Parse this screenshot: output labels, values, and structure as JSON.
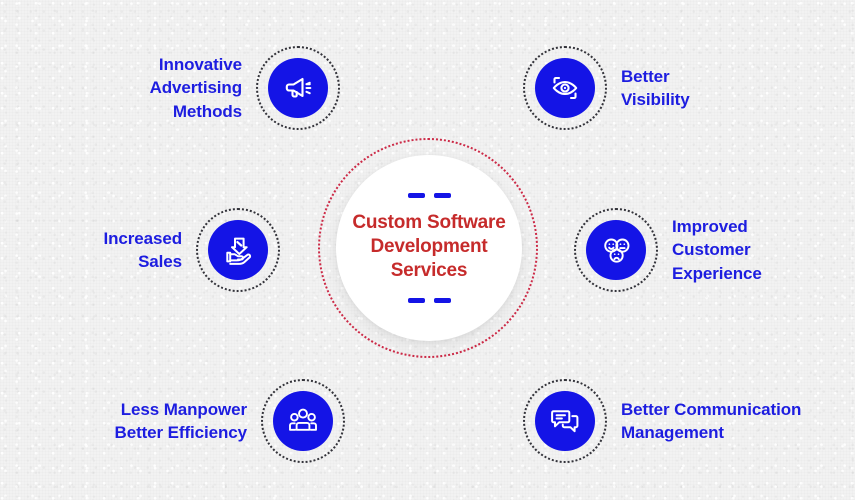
{
  "palette": {
    "background": "#f2f2f2",
    "icon_blue": "#1414e6",
    "label_blue": "#1d1de0",
    "center_red": "#c62b2b",
    "ring_red": "#cc2a47",
    "ring_dark": "#33333a",
    "center_disc": "#ffffff"
  },
  "center": {
    "title": "Custom Software\nDevelopment\nServices"
  },
  "nodes": [
    {
      "id": "innovative-advertising",
      "label": "Innovative\nAdvertising\nMethods",
      "icon": "megaphone-icon",
      "side": "left"
    },
    {
      "id": "better-visibility",
      "label": "Better\nVisibility",
      "icon": "eye-focus-icon",
      "side": "right"
    },
    {
      "id": "increased-sales",
      "label": "Increased\nSales",
      "icon": "hand-discount-arrow-icon",
      "side": "left"
    },
    {
      "id": "improved-customer",
      "label": "Improved\nCustomer\nExperience",
      "icon": "emoji-faces-icon",
      "side": "right"
    },
    {
      "id": "less-manpower",
      "label": "Less Manpower\nBetter Efficiency",
      "icon": "people-group-icon",
      "side": "left"
    },
    {
      "id": "better-communication",
      "label": "Better Communication\nManagement",
      "icon": "chat-bubbles-icon",
      "side": "right"
    }
  ]
}
